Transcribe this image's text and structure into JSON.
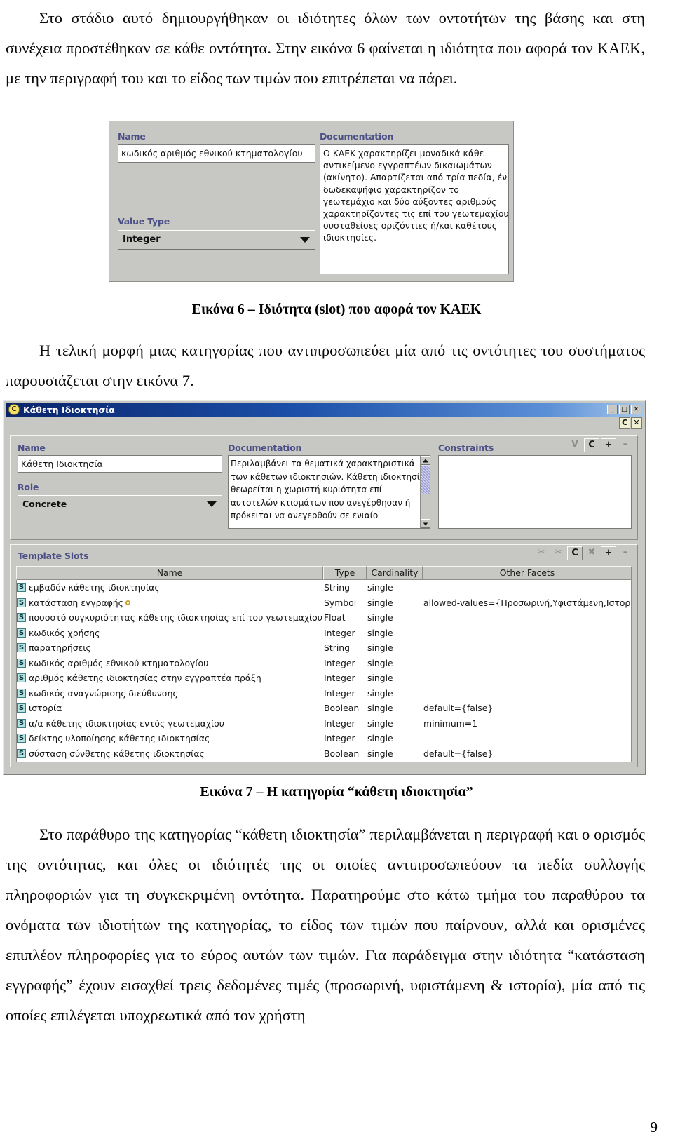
{
  "document": {
    "paragraph_1": "Στο στάδιο αυτό δημιουργήθηκαν οι ιδιότητες όλων των οντοτήτων της βάσης και στη συνέχεια προστέθηκαν σε κάθε οντότητα. Στην εικόνα 6 φαίνεται η ιδιότητα που αφορά τον ΚΑΕΚ, με την περιγραφή του και το είδος των τιμών που επιτρέπεται να πάρει.",
    "caption_6": "Εικόνα 6 – Ιδιότητα (slot) που αφορά τον ΚΑΕΚ",
    "paragraph_2": "Η τελική μορφή μιας κατηγορίας που αντιπροσωπεύει μία από τις οντότητες του συστήματος παρουσιάζεται στην εικόνα 7.",
    "caption_7": "Εικόνα 7 – Η κατηγορία “κάθετη ιδιοκτησία”",
    "paragraph_3": "Στο παράθυρο της κατηγορίας “κάθετη ιδιοκτησία” περιλαμβάνεται η περιγραφή και ο ορισμός της οντότητας, και όλες οι ιδιότητές της οι οποίες αντιπροσωπεύουν τα πεδία συλλογής πληροφοριών για τη συγκεκριμένη οντότητα. Παρατηρούμε στο κάτω τμήμα του παραθύρου τα ονόματα των ιδιοτήτων της κατηγορίας, το είδος των τιμών που παίρνουν, αλλά και ορισμένες επιπλέον πληροφορίες για το εύρος αυτών των τιμών. Για παράδειγμα στην ιδιότητα “κατάσταση εγγραφής” έχουν εισαχθεί τρεις δεδομένες τιμές (προσωρινή, υφιστάμενη & ιστορία), μία από τις οποίες επιλέγεται υποχρεωτικά από τον χρήστη",
    "page_number": "9"
  },
  "figure6": {
    "name_label": "Name",
    "name_value": "κωδικός αριθμός εθνικού κτηματολογίου",
    "value_type_label": "Value Type",
    "value_type_value": "Integer",
    "documentation_label": "Documentation",
    "documentation_lines": [
      "Ο ΚΑΕΚ χαρακτηρίζει μοναδικά κάθε",
      "αντικείμενο εγγραπτέων δικαιωμάτων",
      "(ακίνητο). Απαρτίζεται από τρία πεδία, ένα",
      "δωδεκαψήφιο χαρακτηρίζον το",
      "γεωτεμάχιο και δύο αύξοντες αριθμούς",
      "χαρακτηρίζοντες τις επί του γεωτεμαχίου",
      "συσταθείσες οριζόντιες ή/και καθέτους",
      "ιδιοκτησίες."
    ]
  },
  "figure7": {
    "window_title": "Κάθετη Ιδιοκτησία",
    "window_icon": "class-icon-C",
    "window_buttons": [
      "_",
      "□",
      "✕"
    ],
    "sub_buttons": [
      "C",
      "✕"
    ],
    "name_label": "Name",
    "name_value": "Κάθετη Ιδιοκτησία",
    "role_label": "Role",
    "role_value": "Concrete",
    "documentation_label": "Documentation",
    "documentation_lines": [
      "Περιλαμβάνει τα θεματικά χαρακτηριστικά",
      "των κάθετων ιδιοκτησιών. Κάθετη ιδιοκτησία",
      "θεωρείται η χωριστή κυριότητα επί",
      "αυτοτελών κτισμάτων που ανεγέρθησαν ή",
      "πρόκειται να ανεγερθούν σε ενιαίο"
    ],
    "constraints_label": "Constraints",
    "constraints_buttons": [
      "V",
      "C",
      "+",
      "–"
    ],
    "template_slots_label": "Template Slots",
    "template_slots_buttons": [
      "✂",
      "✂",
      "C",
      "✖",
      "+",
      "–"
    ],
    "columns": [
      "Name",
      "Type",
      "Cardinality",
      "Other Facets"
    ],
    "rows": [
      {
        "badge": "S",
        "name": "εμβαδόν κάθετης ιδιοκτησίας",
        "marked": false,
        "type": "String",
        "cardinality": "single",
        "facets": ""
      },
      {
        "badge": "S",
        "name": "κατάσταση εγγραφής",
        "marked": true,
        "type": "Symbol",
        "cardinality": "single",
        "facets": "allowed-values={Προσωρινή,Υφιστάμενη,Ιστορία}"
      },
      {
        "badge": "S",
        "name": "ποσοστό συγκυριότητας κάθετης ιδιοκτησίας επί του γεωτεμαχίου",
        "marked": false,
        "type": "Float",
        "cardinality": "single",
        "facets": ""
      },
      {
        "badge": "S",
        "name": "κωδικός χρήσης",
        "marked": false,
        "type": "Integer",
        "cardinality": "single",
        "facets": ""
      },
      {
        "badge": "S",
        "name": "παρατηρήσεις",
        "marked": false,
        "type": "String",
        "cardinality": "single",
        "facets": ""
      },
      {
        "badge": "S",
        "name": "κωδικός αριθμός εθνικού κτηματολογίου",
        "marked": false,
        "type": "Integer",
        "cardinality": "single",
        "facets": ""
      },
      {
        "badge": "S",
        "name": "αριθμός κάθετης ιδιοκτησίας στην εγγραπτέα πράξη",
        "marked": false,
        "type": "Integer",
        "cardinality": "single",
        "facets": ""
      },
      {
        "badge": "S",
        "name": "κωδικός αναγνώρισης διεύθυνσης",
        "marked": false,
        "type": "Integer",
        "cardinality": "single",
        "facets": ""
      },
      {
        "badge": "S",
        "name": "ιστορία",
        "marked": false,
        "type": "Boolean",
        "cardinality": "single",
        "facets": "default={false}"
      },
      {
        "badge": "S",
        "name": "α/α κάθετης ιδιοκτησίας εντός γεωτεμαχίου",
        "marked": false,
        "type": "Integer",
        "cardinality": "single",
        "facets": "minimum=1"
      },
      {
        "badge": "S",
        "name": "δείκτης υλοποίησης κάθετης ιδιοκτησίας",
        "marked": false,
        "type": "Integer",
        "cardinality": "single",
        "facets": ""
      },
      {
        "badge": "S",
        "name": "σύσταση σύνθετης κάθετης ιδιοκτησίας",
        "marked": false,
        "type": "Boolean",
        "cardinality": "single",
        "facets": "default={false}"
      }
    ]
  },
  "colors": {
    "titlebar_start": "#0a246a",
    "titlebar_end": "#a6c8ec",
    "panel": "#c7c7c4",
    "label_blue": "#4b4f86",
    "badge_cyan": "#b7e2e2",
    "scroll_thumb": "#9b9bd4"
  }
}
